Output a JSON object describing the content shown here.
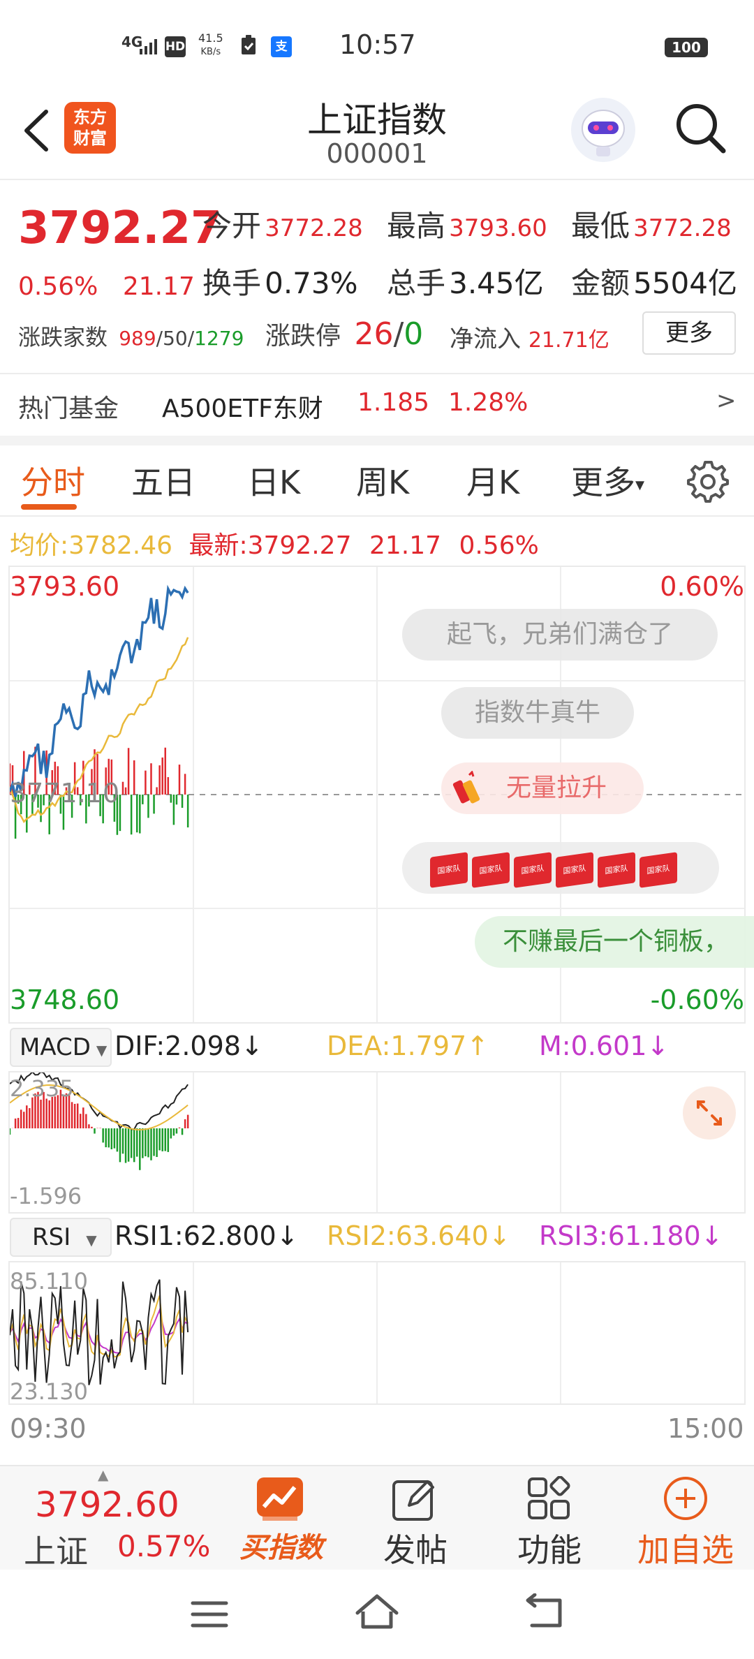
{
  "status_bar": {
    "network": "4G",
    "hd": "HD",
    "speed_value": "41.5",
    "speed_unit": "KB/s",
    "alipay": "支",
    "time": "10:57",
    "battery": "100"
  },
  "header": {
    "logo_text_line1": "东方",
    "logo_text_line2": "财富",
    "title": "上证指数",
    "code": "000001"
  },
  "quote": {
    "price": "3792.27",
    "change_pct": "0.56%",
    "change_abs": "21.17",
    "open_label": "今开",
    "open_value": "3772.28",
    "high_label": "最高",
    "high_value": "3793.60",
    "low_label": "最低",
    "low_value": "3772.28",
    "turnover_label": "换手",
    "turnover_value": "0.73%",
    "volume_label": "总手",
    "volume_value": "3.45亿",
    "amount_label": "金额",
    "amount_value": "5504亿",
    "breadth_label": "涨跌家数",
    "breadth_up": "989",
    "breadth_sep1": "/",
    "breadth_flat": "50",
    "breadth_sep2": "/",
    "breadth_down": "1279",
    "limit_label": "涨跌停",
    "limit_up": "26",
    "limit_sep": "/",
    "limit_down": "0",
    "netflow_label": "净流入",
    "netflow_value": "21.71亿",
    "more_button": "更多"
  },
  "hot_fund": {
    "label": "热门基金",
    "name": "A500ETF东财",
    "price": "1.185",
    "change": "1.28%",
    "arrow": ">"
  },
  "tabs": [
    "分时",
    "五日",
    "日K",
    "周K",
    "月K",
    "更多"
  ],
  "tab_more_caret": "▾",
  "chart_header": {
    "avg_label": "均价:",
    "avg_value": "3782.46",
    "latest_label": "最新:",
    "latest_value": "3792.27",
    "latest_change": "21.17",
    "latest_pct": "0.56%"
  },
  "chart_axes": {
    "top_price": "3793.60",
    "top_pct": "0.60%",
    "mid_price": "3771.10",
    "bottom_price": "3748.60",
    "bottom_pct": "-0.60%",
    "time_start": "09:30",
    "time_end": "15:00"
  },
  "comments": {
    "c1": "起飞，兄弟们满仓了",
    "c2": "指数牛真牛",
    "c3": "无量拉升",
    "c5": "不赚最后一个铜板，",
    "flag_label": "国家队"
  },
  "macd": {
    "selector": "MACD",
    "dif": "DIF:2.098↓",
    "dea": "DEA:1.797↑",
    "m": "M:0.601↓",
    "top": "2.335",
    "bottom": "-1.596"
  },
  "rsi": {
    "selector": "RSI",
    "rsi1": "RSI1:62.800↓",
    "rsi2": "RSI2:63.640↓",
    "rsi3": "RSI3:61.180↓",
    "top": "85.110",
    "bottom": "23.130"
  },
  "bottom_bar": {
    "index_price": "3792.60",
    "index_name": "上证",
    "index_pct": "0.57%",
    "buy_label": "买指数",
    "post_label": "发帖",
    "func_label": "功能",
    "watch_label": "加自选"
  },
  "colors": {
    "up": "#e0282e",
    "down": "#1a9c2a",
    "accent": "#e85b1b",
    "price_line": "#2c6fb3",
    "avg_line": "#e9b93a",
    "macd_dea": "#e9b93a",
    "rsi_purple": "#c339c9"
  },
  "icons": [
    "back-icon",
    "search-icon",
    "gear-icon",
    "expand-icon",
    "post-icon",
    "function-icon",
    "add-icon",
    "menu-icon",
    "home-icon",
    "return-icon"
  ]
}
